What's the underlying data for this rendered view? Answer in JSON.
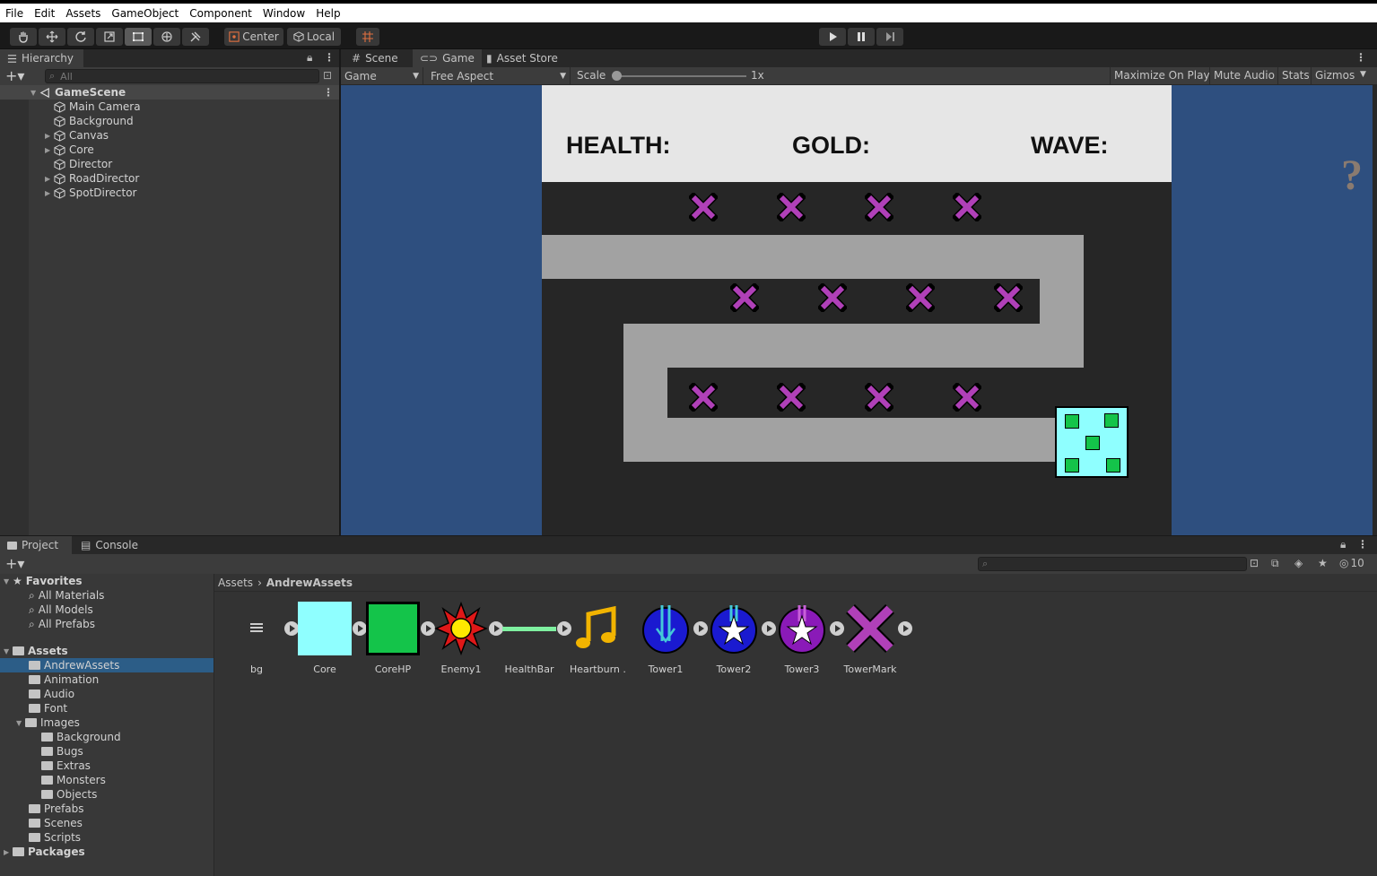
{
  "menu": [
    "File",
    "Edit",
    "Assets",
    "GameObject",
    "Component",
    "Window",
    "Help"
  ],
  "toolbar": {
    "pivot_label": "Center",
    "space_label": "Local"
  },
  "hierarchy": {
    "tab_label": "Hierarchy",
    "search_placeholder": "All",
    "scene_name": "GameScene",
    "items": [
      {
        "label": "Main Camera",
        "expandable": false
      },
      {
        "label": "Background",
        "expandable": false
      },
      {
        "label": "Canvas",
        "expandable": true
      },
      {
        "label": "Core",
        "expandable": true
      },
      {
        "label": "Director",
        "expandable": false
      },
      {
        "label": "RoadDirector",
        "expandable": true
      },
      {
        "label": "SpotDirector",
        "expandable": true
      }
    ]
  },
  "view_tabs": [
    "Scene",
    "Game",
    "Asset Store"
  ],
  "gamebar": {
    "display": "Game",
    "aspect": "Free Aspect",
    "scale_label": "Scale",
    "scale_value": "1x",
    "maximize": "Maximize On Play",
    "mute": "Mute Audio",
    "stats": "Stats",
    "gizmos": "Gizmos"
  },
  "hud": {
    "health": "HEALTH:",
    "gold": "GOLD:",
    "wave": "WAVE:"
  },
  "help_glyph": "?",
  "bottom_tabs": [
    "Project",
    "Console"
  ],
  "hidden_count": "10",
  "project_tree": {
    "favorites_label": "Favorites",
    "favorites": [
      "All Materials",
      "All Models",
      "All Prefabs"
    ],
    "assets_label": "Assets",
    "assets": [
      "AndrewAssets",
      "Animation",
      "Audio",
      "Font",
      "Images",
      "Prefabs",
      "Scenes",
      "Scripts"
    ],
    "images_children": [
      "Background",
      "Bugs",
      "Extras",
      "Monsters",
      "Objects"
    ],
    "packages_label": "Packages",
    "selected": "AndrewAssets"
  },
  "breadcrumb": {
    "root": "Assets",
    "current": "AndrewAssets"
  },
  "assets": [
    {
      "label": "bg"
    },
    {
      "label": "Core"
    },
    {
      "label": "CoreHP"
    },
    {
      "label": "Enemy1"
    },
    {
      "label": "HealthBar"
    },
    {
      "label": "Heartburn ..."
    },
    {
      "label": "Tower1"
    },
    {
      "label": "Tower2"
    },
    {
      "label": "Tower3"
    },
    {
      "label": "TowerMark"
    }
  ],
  "colors": {
    "game_bg": "#2e4f7f",
    "hud_bg": "#e6e6e6",
    "road": "#a2a2a2",
    "mark": "#b040b8",
    "core": "#8fffff",
    "core_square": "#14c44a",
    "selection": "#2c5d87"
  }
}
